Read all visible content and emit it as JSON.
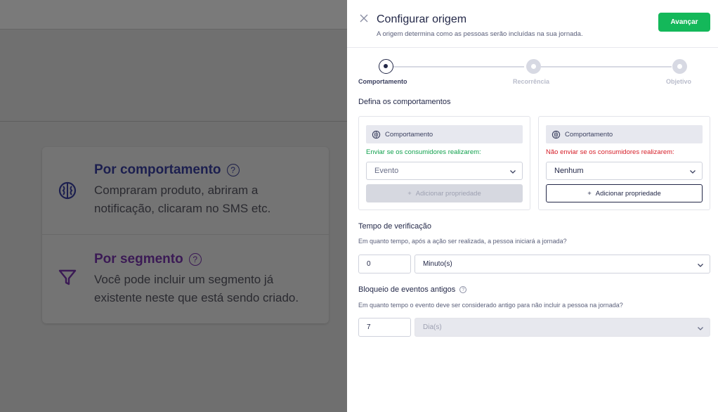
{
  "background": {
    "options": [
      {
        "title": "Por comportamento",
        "description": "Compraram produto, abriram a notificação, clicaram no SMS etc.",
        "icon": "brain-icon"
      },
      {
        "title": "Por segmento",
        "description": "Você pode incluir um segmento já existente neste que está sendo criado.",
        "icon": "filter-icon"
      }
    ],
    "help_glyph": "?"
  },
  "drawer": {
    "title": "Configurar origem",
    "subtitle": "A origem determina como as pessoas serão incluídas na sua jornada.",
    "advance_label": "Avançar",
    "steps": [
      {
        "label": "Comportamento",
        "state": "active"
      },
      {
        "label": "Recorrência",
        "state": "inactive"
      },
      {
        "label": "Objetivo",
        "state": "inactive"
      }
    ],
    "behaviors": {
      "title": "Defina os comportamentos",
      "include": {
        "header": "Comportamento",
        "rule": "Enviar se os consumidores realizarem:",
        "select_value": "Evento",
        "add_label": "Adicionar propriedade",
        "add_enabled": false
      },
      "exclude": {
        "header": "Comportamento",
        "rule": "Não enviar se os consumidores realizarem:",
        "select_value": "Nenhum",
        "add_label": "Adicionar propriedade",
        "add_enabled": true
      }
    },
    "verification": {
      "title": "Tempo de verificação",
      "description": "Em quanto tempo, após a ação ser realizada, a pessoa iniciará a jornada?",
      "value": "0",
      "unit": "Minuto(s)"
    },
    "old_events": {
      "title": "Bloqueio de eventos antigos",
      "help_glyph": "?",
      "description": "Em quanto tempo o evento deve ser considerado antigo para não incluir a pessoa na jornada?",
      "value": "7",
      "unit": "Dia(s)",
      "unit_disabled": true
    }
  },
  "colors": {
    "primary": "#232848",
    "accent_green": "#14b85a",
    "include_green": "#12a14e",
    "exclude_red": "#d6202a",
    "overlay": "#6f6f6f"
  }
}
